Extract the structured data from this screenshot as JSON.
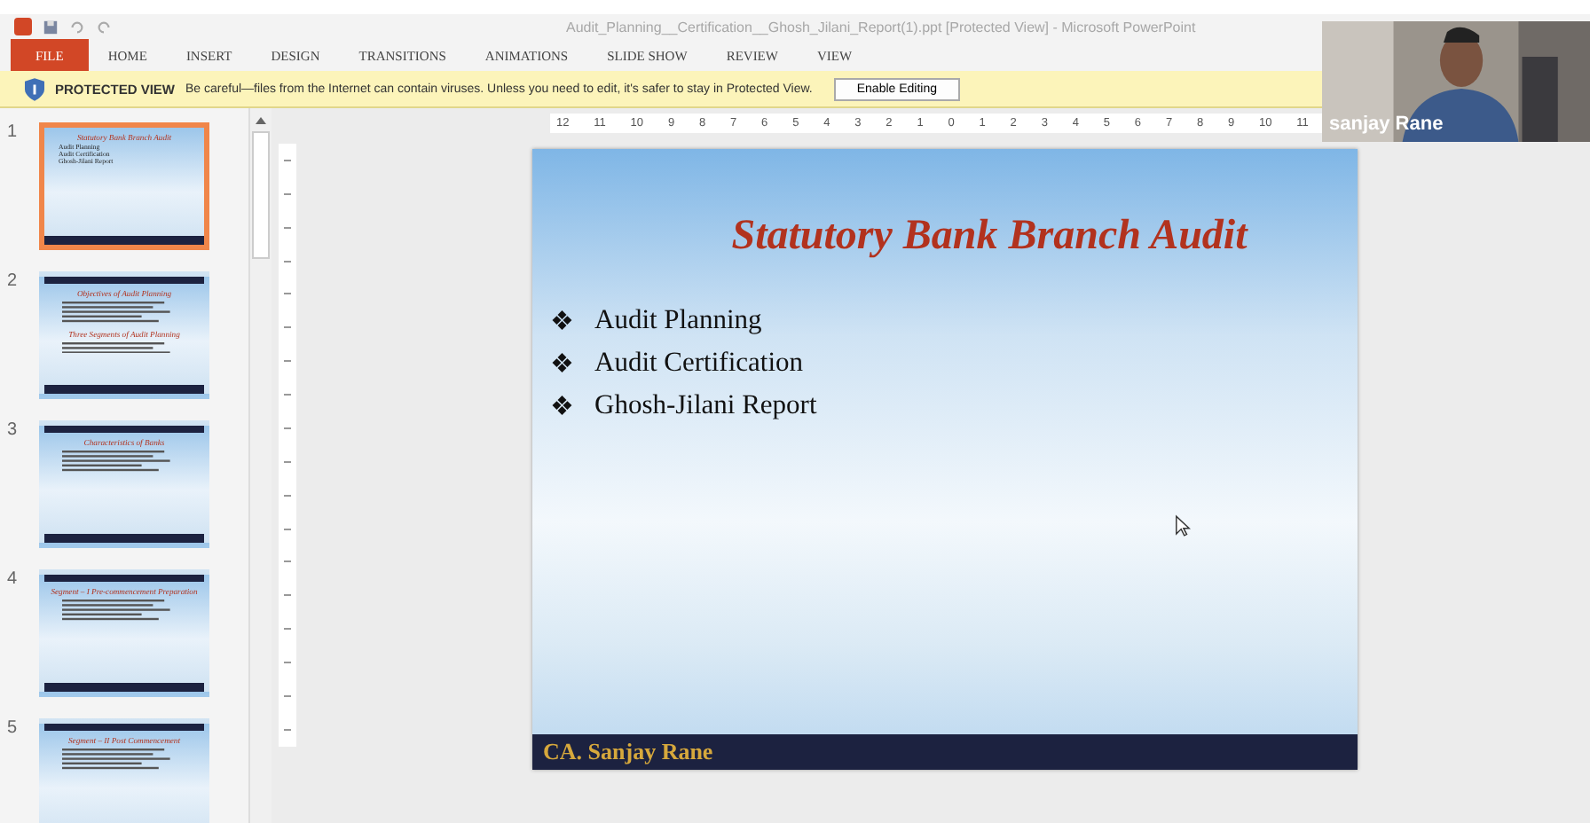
{
  "window": {
    "title": "Audit_Planning__Certification__Ghosh_Jilani_Report(1).ppt [Protected View] - Microsoft PowerPoint"
  },
  "ribbon_tabs": [
    {
      "label": "FILE",
      "kind": "file",
      "selected": false
    },
    {
      "label": "HOME",
      "kind": "tab",
      "selected": false
    },
    {
      "label": "INSERT",
      "kind": "tab",
      "selected": false
    },
    {
      "label": "DESIGN",
      "kind": "tab",
      "selected": false
    },
    {
      "label": "TRANSITIONS",
      "kind": "tab",
      "selected": false
    },
    {
      "label": "ANIMATIONS",
      "kind": "tab",
      "selected": false
    },
    {
      "label": "SLIDE SHOW",
      "kind": "tab",
      "selected": false
    },
    {
      "label": "REVIEW",
      "kind": "tab",
      "selected": false
    },
    {
      "label": "VIEW",
      "kind": "tab",
      "selected": false
    }
  ],
  "protected_bar": {
    "title": "PROTECTED VIEW",
    "message": "Be careful—files from the Internet can contain viruses. Unless you need to edit, it's safer to stay in Protected View.",
    "button": "Enable Editing"
  },
  "thumbnails": [
    {
      "number": "1",
      "selected": true,
      "kind": "title",
      "titles": [
        "Statutory Bank Branch Audit"
      ],
      "bullets": [
        "Audit Planning",
        "Audit Certification",
        "Ghosh-Jilani Report"
      ]
    },
    {
      "number": "2",
      "selected": false,
      "kind": "content",
      "titles": [
        "Objectives of Audit Planning",
        "Three Segments of Audit Planning"
      ]
    },
    {
      "number": "3",
      "selected": false,
      "kind": "content",
      "titles": [
        "Characteristics of Banks"
      ]
    },
    {
      "number": "4",
      "selected": false,
      "kind": "content",
      "titles": [
        "Segment – I Pre-commencement Preparation"
      ]
    },
    {
      "number": "5",
      "selected": false,
      "kind": "content",
      "titles": [
        "Segment – II Post Commencement"
      ]
    }
  ],
  "ruler": [
    "12",
    "11",
    "10",
    "9",
    "8",
    "7",
    "6",
    "5",
    "4",
    "3",
    "2",
    "1",
    "0",
    "1",
    "2",
    "3",
    "4",
    "5",
    "6",
    "7",
    "8",
    "9",
    "10",
    "11"
  ],
  "slide": {
    "title": "Statutory Bank Branch Audit",
    "bullet_mark": "❖",
    "bullets": [
      "Audit Planning",
      "Audit Certification",
      "Ghosh-Jilani Report"
    ],
    "footer": "CA. Sanjay Rane"
  },
  "webcam": {
    "name": "sanjay Rane"
  }
}
